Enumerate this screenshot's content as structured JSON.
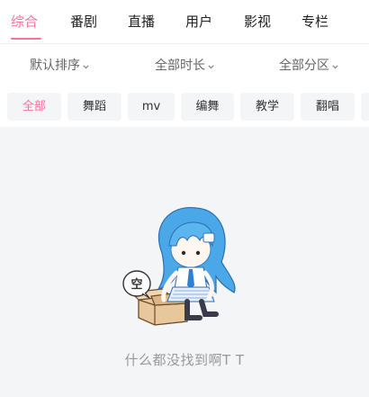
{
  "tabs": [
    {
      "label": "综合",
      "active": true
    },
    {
      "label": "番剧"
    },
    {
      "label": "直播"
    },
    {
      "label": "用户"
    },
    {
      "label": "影视"
    },
    {
      "label": "专栏"
    }
  ],
  "filters": [
    {
      "label": "默认排序"
    },
    {
      "label": "全部时长"
    },
    {
      "label": "全部分区"
    }
  ],
  "chips": [
    {
      "label": "全部",
      "active": true
    },
    {
      "label": "舞蹈"
    },
    {
      "label": "mv"
    },
    {
      "label": "编舞"
    },
    {
      "label": "教学"
    },
    {
      "label": "翻唱"
    }
  ],
  "empty_state": {
    "bubble_text": "空",
    "message": "什么都没找到啊T T"
  },
  "colors": {
    "accent": "#fb7299",
    "background": "#f4f5f7",
    "text_muted": "#999999"
  }
}
